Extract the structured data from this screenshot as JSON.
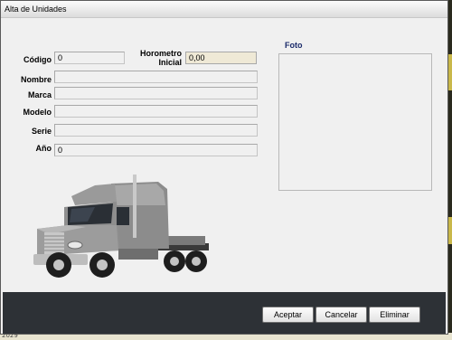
{
  "window": {
    "title": "Alta de Unidades"
  },
  "form": {
    "codigo": {
      "label": "Código",
      "value": "0"
    },
    "horometro": {
      "label_line1": "Horometro",
      "label_line2": "Inicial",
      "value": "0,00"
    },
    "nombre": {
      "label": "Nombre",
      "value": ""
    },
    "marca": {
      "label": "Marca",
      "value": ""
    },
    "modelo": {
      "label": "Modelo",
      "value": ""
    },
    "serie": {
      "label": "Serie",
      "value": ""
    },
    "anio": {
      "label": "Año",
      "value": "0"
    }
  },
  "photo": {
    "label": "Foto"
  },
  "buttons": {
    "accept": "Aceptar",
    "cancel": "Cancelar",
    "delete": "Eliminar"
  },
  "colors": {
    "button_bar": "#2d3136",
    "photo_label": "#1a2a6a",
    "horometro_bg": "#efe9d6"
  },
  "icons": {
    "truck": "semi-truck-illustration"
  },
  "background": {
    "taskbar_fragment": "2029"
  }
}
